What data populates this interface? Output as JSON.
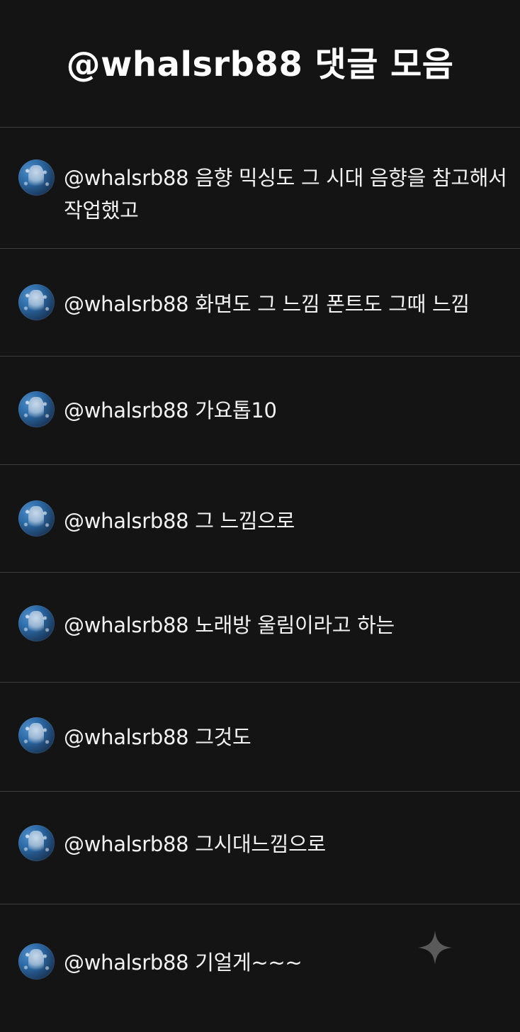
{
  "header": {
    "title": "@whalsrb88 댓글 모음"
  },
  "comments": [
    {
      "username": "@whalsrb88",
      "text": "음향 믹싱도 그 시대 음향을 참고해서 작업했고"
    },
    {
      "username": "@whalsrb88",
      "text": "화면도 그 느낌 폰트도 그때 느낌"
    },
    {
      "username": "@whalsrb88",
      "text": "가요톱10"
    },
    {
      "username": "@whalsrb88",
      "text": "그 느낌으로"
    },
    {
      "username": "@whalsrb88",
      "text": "노래방 울림이라고 하는"
    },
    {
      "username": "@whalsrb88",
      "text": "그것도"
    },
    {
      "username": "@whalsrb88",
      "text": "그시대느낌으로"
    },
    {
      "username": "@whalsrb88",
      "text": "기얼게~~~"
    }
  ],
  "colors": {
    "background": "#141414",
    "divider": "#3c3c3c",
    "text": "#f2f2f2",
    "sparkle": "#5a5a5a"
  },
  "icons": {
    "avatar": "avatar-image",
    "sparkle": "sparkle-icon"
  }
}
